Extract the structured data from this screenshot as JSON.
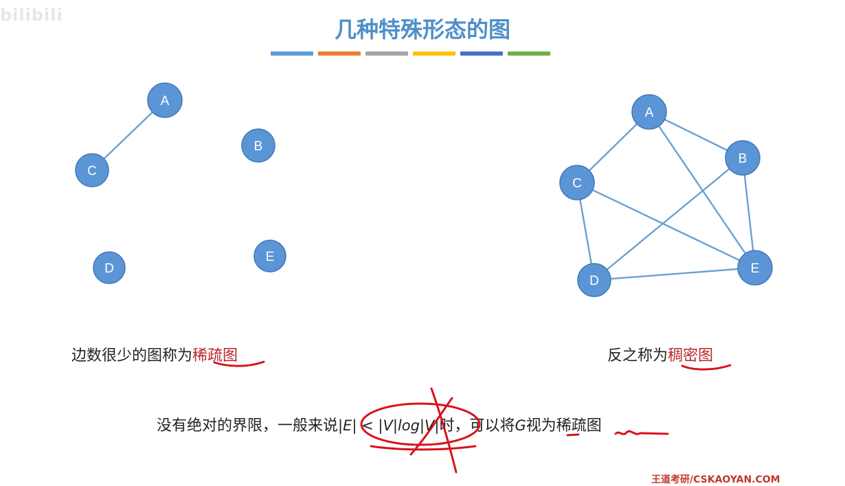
{
  "watermark": "bilibili",
  "title": "几种特殊形态的图",
  "title_bar_colors": [
    "#5b9bd5",
    "#ed7d31",
    "#a5a5a5",
    "#ffc000",
    "#4472c4",
    "#70ad47"
  ],
  "sparse_graph": {
    "nodes": [
      {
        "id": "A",
        "label": "A"
      },
      {
        "id": "B",
        "label": "B"
      },
      {
        "id": "C",
        "label": "C"
      },
      {
        "id": "D",
        "label": "D"
      },
      {
        "id": "E",
        "label": "E"
      }
    ],
    "edges": [
      [
        "A",
        "C"
      ]
    ]
  },
  "dense_graph": {
    "nodes": [
      {
        "id": "A",
        "label": "A"
      },
      {
        "id": "B",
        "label": "B"
      },
      {
        "id": "C",
        "label": "C"
      },
      {
        "id": "D",
        "label": "D"
      },
      {
        "id": "E",
        "label": "E"
      }
    ],
    "edges": [
      [
        "A",
        "B"
      ],
      [
        "A",
        "C"
      ],
      [
        "A",
        "E"
      ],
      [
        "B",
        "D"
      ],
      [
        "B",
        "E"
      ],
      [
        "C",
        "D"
      ],
      [
        "C",
        "E"
      ],
      [
        "D",
        "E"
      ]
    ]
  },
  "captions": {
    "sparse_prefix": "边数很少的图称为",
    "sparse_term": "稀疏图",
    "dense_prefix": "反之称为",
    "dense_term": "稠密图"
  },
  "bottom": {
    "prefix": "没有绝对的界限，一般来说",
    "formula": "|E| < |V|log|V|",
    "suffix_1": "时，可以将",
    "graph_symbol": "G",
    "suffix_2": "视为",
    "term": "稀疏图"
  },
  "colors": {
    "node_fill": "#5b95d6",
    "edge": "#6aa0d2",
    "title": "#4f8fc9",
    "highlight": "#b8252d",
    "ink": "#d8121b"
  },
  "footer": "王道考研/CSKAOYAN.COM"
}
